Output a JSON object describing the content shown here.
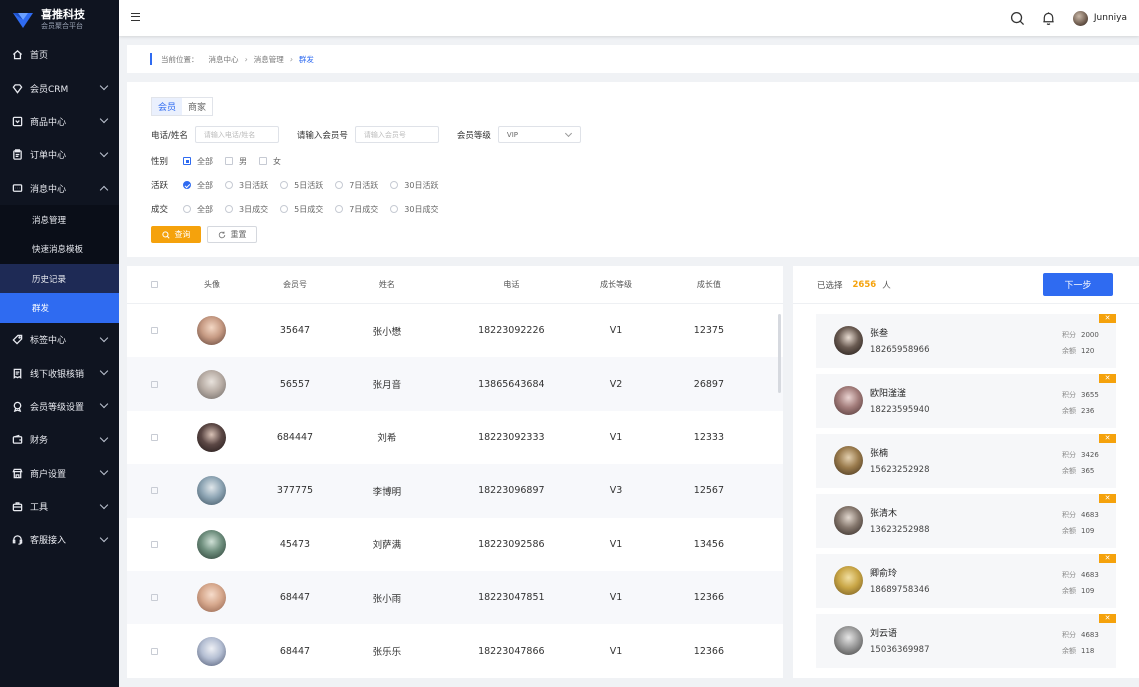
{
  "brand": {
    "name": "喜推科技",
    "subtitle": "会员聚合平台"
  },
  "sidebar": {
    "items": [
      {
        "label": "首页",
        "icon": "home-icon"
      },
      {
        "label": "会员CRM",
        "icon": "diamond-icon"
      },
      {
        "label": "商品中心",
        "icon": "product-icon"
      },
      {
        "label": "订单中心",
        "icon": "clipboard-icon"
      },
      {
        "label": "消息中心",
        "icon": "message-icon"
      },
      {
        "label": "标签中心",
        "icon": "tag-icon"
      },
      {
        "label": "线下收银核销",
        "icon": "receipt-icon"
      },
      {
        "label": "会员等级设置",
        "icon": "medal-icon"
      },
      {
        "label": "财务",
        "icon": "wallet-icon"
      },
      {
        "label": "商户设置",
        "icon": "shop-icon"
      },
      {
        "label": "工具",
        "icon": "toolbox-icon"
      },
      {
        "label": "客服接入",
        "icon": "headset-icon"
      }
    ],
    "submenu": [
      "消息管理",
      "快速消息模板",
      "历史记录",
      "群发"
    ]
  },
  "header": {
    "username": "Junniya"
  },
  "breadcrumb": {
    "prefix": "当前位置：",
    "l1": "消息中心",
    "l2": "消息管理",
    "current": "群发"
  },
  "filter": {
    "tabs": [
      "会员",
      "商家"
    ],
    "phone_label": "电话/姓名",
    "phone_placeholder": "请输入电话/姓名",
    "member_no_label": "请输入会员号",
    "member_no_placeholder": "请输入会员号",
    "level_label": "会员等级",
    "level_value": "VIP",
    "gender_label": "性别",
    "gender_options": [
      "全部",
      "男",
      "女"
    ],
    "active_label": "活跃",
    "active_options": [
      "全部",
      "3日活跃",
      "5日活跃",
      "7日活跃",
      "30日活跃"
    ],
    "deal_label": "成交",
    "deal_options": [
      "全部",
      "3日成交",
      "5日成交",
      "7日成交",
      "30日成交"
    ],
    "search_btn": "查询",
    "reset_btn": "重置"
  },
  "table": {
    "headers": [
      "头像",
      "会员号",
      "姓名",
      "电话",
      "成长等级",
      "成长值"
    ],
    "rows": [
      {
        "no": "35647",
        "name": "张小懋",
        "phone": "18223092226",
        "level": "V1",
        "growth": "12375"
      },
      {
        "no": "56557",
        "name": "张月音",
        "phone": "13865643684",
        "level": "V2",
        "growth": "26897"
      },
      {
        "no": "684447",
        "name": "刘希",
        "phone": "18223092333",
        "level": "V1",
        "growth": "12333"
      },
      {
        "no": "377775",
        "name": "李博明",
        "phone": "18223096897",
        "level": "V3",
        "growth": "12567"
      },
      {
        "no": "45473",
        "name": "刘萨满",
        "phone": "18223092586",
        "level": "V1",
        "growth": "13456"
      },
      {
        "no": "68447",
        "name": "张小雨",
        "phone": "18223047851",
        "level": "V1",
        "growth": "12366"
      },
      {
        "no": "68447",
        "name": "张乐乐",
        "phone": "18223047866",
        "level": "V1",
        "growth": "12366"
      }
    ]
  },
  "selected": {
    "label": "已选择",
    "count": "2656",
    "unit": "人",
    "next_btn": "下一步",
    "points_label": "积分",
    "balance_label": "余额",
    "remove_glyph": "✕",
    "cards": [
      {
        "name": "张叁",
        "phone": "18265958966",
        "points": "2000",
        "balance": "120"
      },
      {
        "name": "欧阳滏滏",
        "phone": "18223595940",
        "points": "3655",
        "balance": "236"
      },
      {
        "name": "张楠",
        "phone": "15623252928",
        "points": "3426",
        "balance": "365"
      },
      {
        "name": "张清木",
        "phone": "13623252988",
        "points": "4683",
        "balance": "109"
      },
      {
        "name": "卿俞玲",
        "phone": "18689758346",
        "points": "4683",
        "balance": "109"
      },
      {
        "name": "刘云语",
        "phone": "15036369987",
        "points": "4683",
        "balance": "118"
      }
    ]
  },
  "colors": {
    "accent": "#2f6bf1",
    "orange": "#f5a20c",
    "sidebar_bg": "#0f1420"
  }
}
